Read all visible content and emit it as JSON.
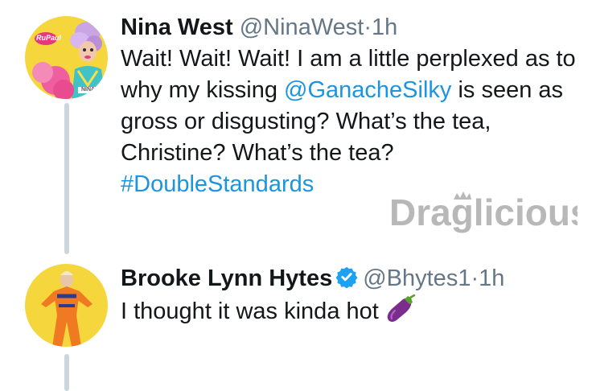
{
  "tweets": [
    {
      "name": "Nina West",
      "handle": "@NinaWest",
      "separator": "·",
      "time": "1h",
      "text_before": "Wait! Wait! Wait! I am a little perplexed as to why my kissing ",
      "mention": "@GanacheSilky",
      "text_after": " is seen as gross or disgusting? What’s the tea, Christine? What’s the tea?",
      "hashtag": "#DoubleStandards",
      "avatar_logo_text": "RuPaul",
      "avatar_corner_text": "NINA"
    },
    {
      "name": "Brooke Lynn Hytes",
      "verified": true,
      "handle": "@Bhytes1",
      "separator": "·",
      "time": "1h",
      "text": "I thought it was kinda hot",
      "emoji": "eggplant"
    }
  ],
  "watermark": "Draglicious",
  "colors": {
    "link": "#1b95e0",
    "muted": "#657786",
    "thread_line": "#ccd6dd",
    "avatar_yellow": "#f5d63c",
    "verified_blue": "#1da1f2"
  }
}
